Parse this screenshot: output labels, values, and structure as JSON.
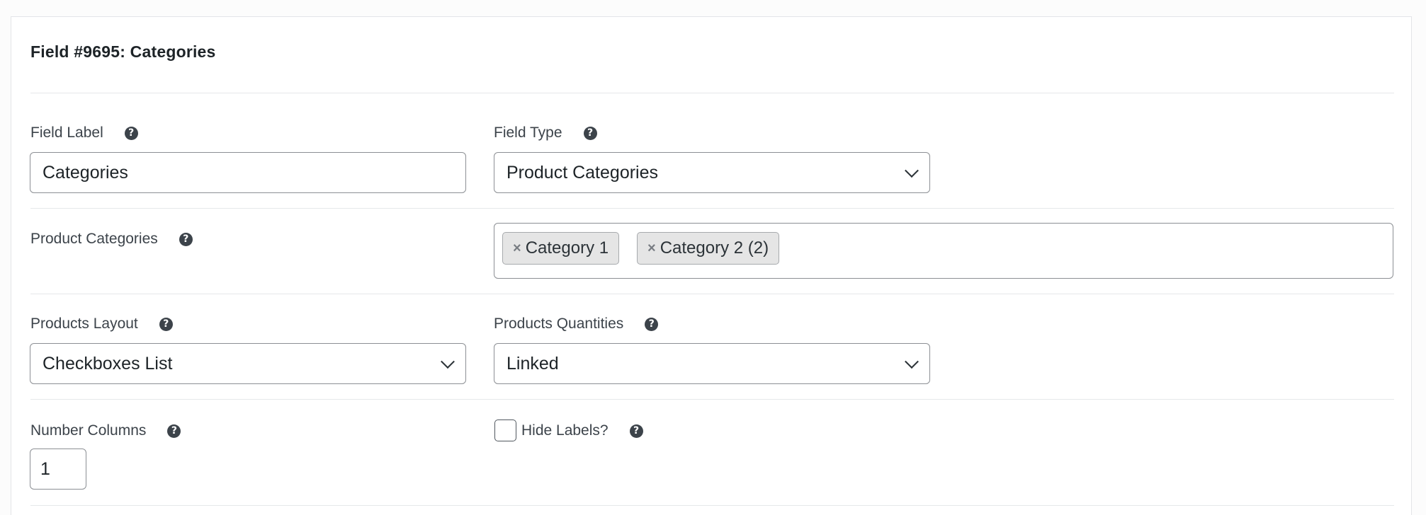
{
  "title": "Field #9695: Categories",
  "field_label": {
    "label": "Field Label",
    "value": "Categories"
  },
  "field_type": {
    "label": "Field Type",
    "value": "Product Categories"
  },
  "product_categories": {
    "label": "Product Categories",
    "chips": [
      {
        "remove": "×",
        "label": "Category 1"
      },
      {
        "remove": "×",
        "label": "Category 2 (2)"
      }
    ]
  },
  "products_layout": {
    "label": "Products Layout",
    "value": "Checkboxes List"
  },
  "products_quantities": {
    "label": "Products Quantities",
    "value": "Linked"
  },
  "number_columns": {
    "label": "Number Columns",
    "value": "1"
  },
  "hide_labels": {
    "label": "Hide Labels?",
    "checked": false
  },
  "help_glyph": "?",
  "icons": {
    "help": "question-circle-icon",
    "dropdown": "chevron-down-icon",
    "remove": "close-icon"
  }
}
